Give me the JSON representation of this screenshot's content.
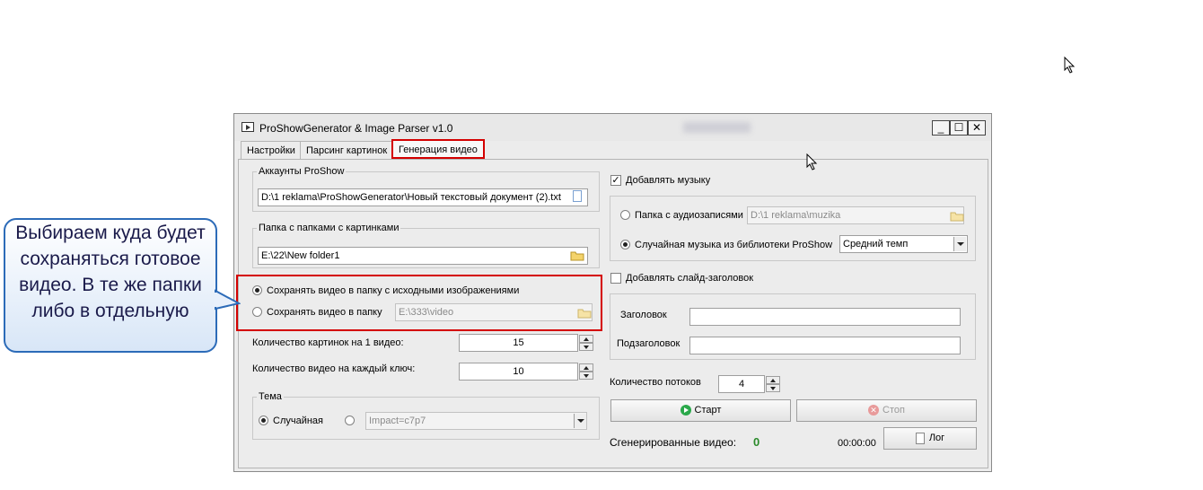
{
  "window": {
    "title": "ProShowGenerator & Image Parser v1.0",
    "controls": {
      "minimize": "_",
      "maximize": "☐",
      "close": "✕"
    }
  },
  "tabs": [
    "Настройки",
    "Парсинг картинок",
    "Генерация видео"
  ],
  "left": {
    "accounts_label": "Аккаунты ProShow",
    "accounts_path": "D:\\1 reklama\\ProShowGenerator\\Новый текстовый документ (2).txt",
    "images_folder_label": "Папка с папками с картинками",
    "images_folder_path": "E:\\22\\New folder1",
    "save_same_label": "Сохранять видео в папку с исходными изображениями",
    "save_custom_label": "Сохранять видео в папку",
    "save_custom_path": "E:\\333\\video",
    "images_per_video_label": "Количество картинок на 1 видео:",
    "images_per_video_value": "15",
    "videos_per_key_label": "Количество видео на каждый ключ:",
    "videos_per_key_value": "10",
    "theme_label": "Тема",
    "theme_random_label": "Случайная",
    "theme_value": "Impact=c7p7"
  },
  "right": {
    "add_music_label": "Добавлять музыку",
    "audio_folder_label": "Папка с аудиозаписями",
    "audio_folder_path": "D:\\1 reklama\\muzika",
    "random_music_label": "Случайная музыка из библиотеки ProShow",
    "tempo_value": "Средний темп",
    "add_title_slide_label": "Добавлять слайд-заголовок",
    "title_label": "Заголовок",
    "title_value": "",
    "subtitle_label": "Подзаголовок",
    "subtitle_value": "",
    "threads_label": "Количество потоков",
    "threads_value": "4",
    "start_label": "Старт",
    "stop_label": "Стоп",
    "generated_label": "Сгенерированные видео:",
    "generated_count": "0",
    "timer": "00:00:00",
    "log_label": "Лог"
  },
  "callout": {
    "text": "Выбираем куда будет сохраняться готовое видео. В те же папки либо в отдельную"
  },
  "colors": {
    "highlight": "#d40000",
    "callout_border": "#2c6bb8",
    "start_icon": "#2aa84a",
    "stop_icon": "#e06a6a",
    "count_green": "#2a8a2a"
  }
}
